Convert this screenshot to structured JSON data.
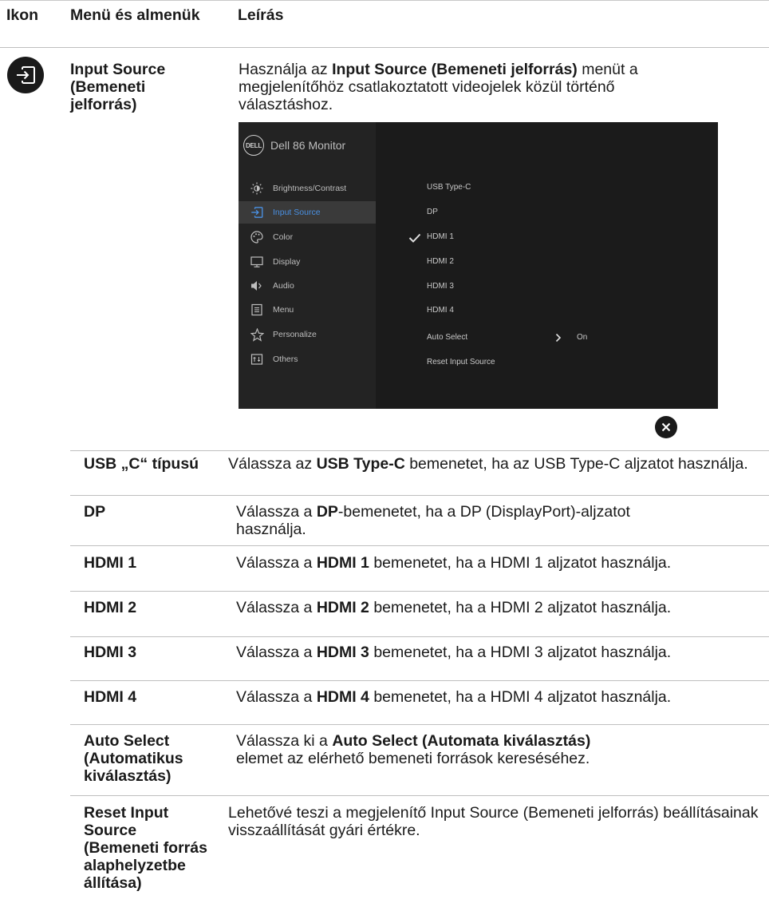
{
  "header": {
    "col_icon": "Ikon",
    "col_menu": "Menü és almenük",
    "col_desc": "Leírás"
  },
  "main_row": {
    "icon": "input-source-icon",
    "menu_label": "Input Source (Bemeneti jelforrás)",
    "desc_pre": "Használja az ",
    "desc_bold": "Input Source (Bemeneti jelforrás)",
    "desc_post": " menüt a megjelenítőhöz csatlakoztatott videojelek közül történő választáshoz."
  },
  "osd": {
    "logo": "DELL",
    "title": "Dell 86 Monitor",
    "menu": [
      {
        "label": "Brightness/Contrast",
        "icon": "brightness-icon"
      },
      {
        "label": "Input Source",
        "icon": "input-source-icon",
        "active": true
      },
      {
        "label": "Color",
        "icon": "color-icon"
      },
      {
        "label": "Display",
        "icon": "display-icon"
      },
      {
        "label": "Audio",
        "icon": "audio-icon"
      },
      {
        "label": "Menu",
        "icon": "menu-icon"
      },
      {
        "label": "Personalize",
        "icon": "star-icon"
      },
      {
        "label": "Others",
        "icon": "others-icon"
      }
    ],
    "submenu": [
      {
        "label": "USB Type-C"
      },
      {
        "label": "DP"
      },
      {
        "label": "HDMI 1",
        "checked": true
      },
      {
        "label": "HDMI 2"
      },
      {
        "label": "HDMI 3"
      },
      {
        "label": "HDMI 4"
      },
      {
        "label": "Auto Select",
        "value": "On"
      },
      {
        "label": "Reset Input Source"
      }
    ],
    "selected_input": "HDMI 1"
  },
  "rows": [
    {
      "name": "USB „C“ típusú",
      "pre": "Válassza az ",
      "bold": "USB Type-C",
      "post": " bemenetet, ha az USB Type-C aljzatot használja."
    },
    {
      "name": "DP",
      "pre": "Válassza a ",
      "bold": "DP",
      "post": "-bemenetet, ha a DP (DisplayPort)-aljzatot használja."
    },
    {
      "name": "HDMI 1",
      "pre": "Válassza a ",
      "bold": "HDMI 1",
      "post": " bemenetet, ha a HDMI 1 aljzatot használja."
    },
    {
      "name": "HDMI 2",
      "pre": "Válassza a ",
      "bold": "HDMI 2",
      "post": " bemenetet, ha a HDMI 2 aljzatot használja."
    },
    {
      "name": "HDMI 3",
      "pre": "Válassza a ",
      "bold": "HDMI 3",
      "post": " bemenetet, ha a HDMI 3 aljzatot használja."
    },
    {
      "name": "HDMI 4",
      "pre": "Válassza a ",
      "bold": "HDMI 4",
      "post": " bemenetet, ha a HDMI 4 aljzatot használja."
    },
    {
      "name": "Auto Select (Automatikus kiválasztás)",
      "pre": "Válassza ki a ",
      "bold": "Auto Select (Automata kiválasztás)",
      "post": " elemet az elérhető bemeneti források kereséséhez."
    },
    {
      "name": "Reset Input Source (Bemeneti forrás alaphelyzetbe állítása)",
      "pre": "Lehetővé teszi a megjelenítő ",
      "bold": "",
      "mid": "Input Source (Bemeneti jelforrás)",
      "post": " beállításainak visszaállítását gyári értékre."
    }
  ]
}
